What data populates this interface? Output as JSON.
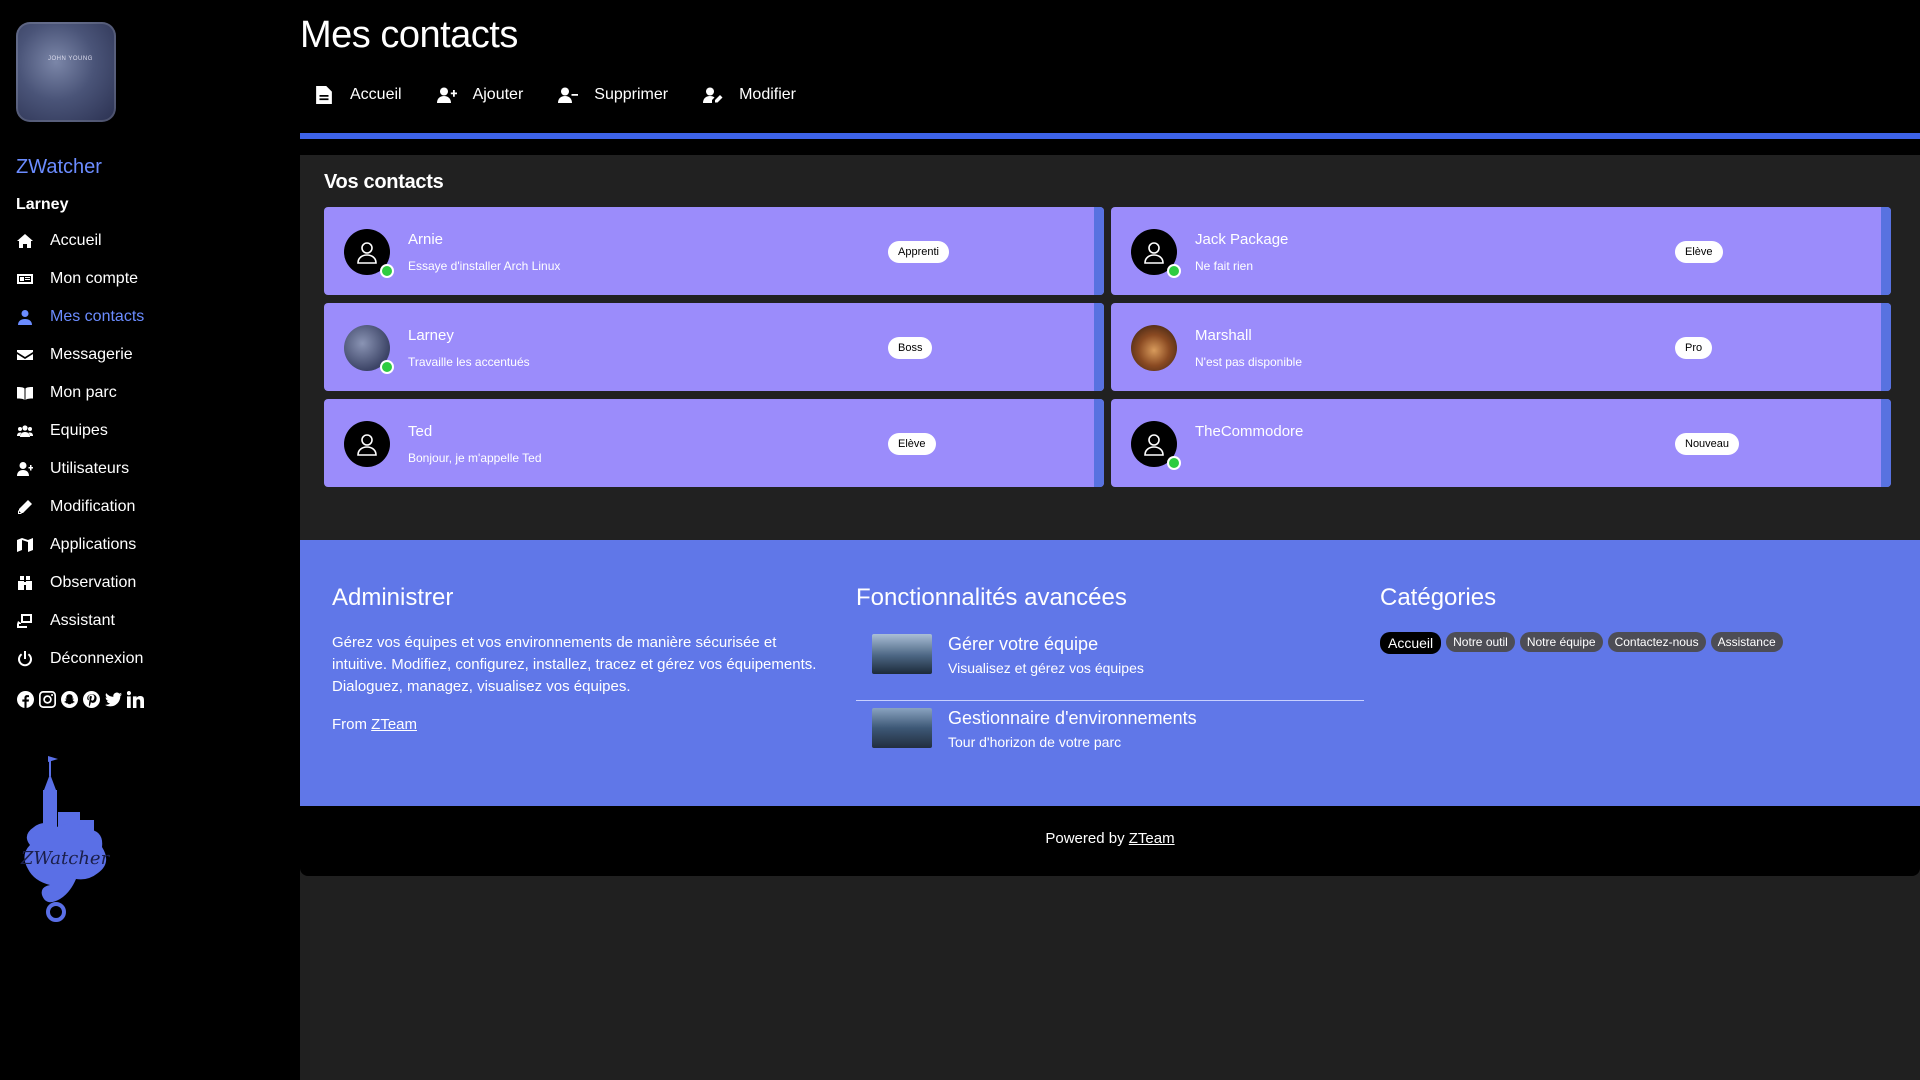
{
  "sidebar": {
    "brand": "ZWatcher",
    "username": "Larney",
    "avatar_text": "JOHN YOUNG",
    "items": [
      {
        "label": "Accueil",
        "icon": "home-icon"
      },
      {
        "label": "Mon compte",
        "icon": "id-card-icon"
      },
      {
        "label": "Mes contacts",
        "icon": "user-icon",
        "active": true
      },
      {
        "label": "Messagerie",
        "icon": "envelope-icon"
      },
      {
        "label": "Mon parc",
        "icon": "book-icon"
      },
      {
        "label": "Equipes",
        "icon": "users-icon"
      },
      {
        "label": "Utilisateurs",
        "icon": "user-plus-icon"
      },
      {
        "label": "Modification",
        "icon": "pencil-icon"
      },
      {
        "label": "Applications",
        "icon": "map-icon"
      },
      {
        "label": "Observation",
        "icon": "binoculars-icon"
      },
      {
        "label": "Assistant",
        "icon": "assistant-icon"
      },
      {
        "label": "Déconnexion",
        "icon": "power-icon"
      }
    ],
    "socials": [
      "facebook-icon",
      "instagram-icon",
      "snapchat-icon",
      "pinterest-icon",
      "twitter-icon",
      "linkedin-icon"
    ],
    "logo_text": "ZWatcher"
  },
  "header": {
    "title": "Mes contacts",
    "tabs": [
      {
        "label": "Accueil",
        "icon": "file-icon"
      },
      {
        "label": "Ajouter",
        "icon": "user-plus-icon"
      },
      {
        "label": "Supprimer",
        "icon": "user-minus-icon"
      },
      {
        "label": "Modifier",
        "icon": "user-edit-icon"
      }
    ]
  },
  "contacts": {
    "title": "Vos contacts",
    "items": [
      {
        "name": "Arnie",
        "status": "Essaye d'installer Arch Linux",
        "badge": "Apprenti",
        "online": true,
        "photo": "none"
      },
      {
        "name": "Jack Package",
        "status": "Ne fait rien",
        "badge": "Elève",
        "online": true,
        "photo": "none"
      },
      {
        "name": "Larney",
        "status": "Travaille les accentués",
        "badge": "Boss",
        "online": true,
        "photo": "larney"
      },
      {
        "name": "Marshall",
        "status": "N'est pas disponible",
        "badge": "Pro",
        "online": false,
        "photo": "marshall"
      },
      {
        "name": "Ted",
        "status": "Bonjour, je m'appelle Ted",
        "badge": "Elève",
        "online": false,
        "photo": "none"
      },
      {
        "name": "TheCommodore",
        "status": "",
        "badge": "Nouveau",
        "online": true,
        "photo": "none"
      }
    ]
  },
  "footer": {
    "admin": {
      "title": "Administrer",
      "text": "Gérez vos équipes et vos environnements de manière sécurisée et intuitive. Modifiez, configurez, installez, tracez et gérez vos équipements. Dialoguez, managez, visualisez vos équipes.",
      "from_prefix": "From ",
      "from_link": "ZTeam"
    },
    "features": {
      "title": "Fonctionnalités avancées",
      "items": [
        {
          "title": "Gérer votre équipe",
          "subtitle": "Visualisez et gérez vos équipes"
        },
        {
          "title": "Gestionnaire d'environnements",
          "subtitle": "Tour d'horizon de votre parc"
        }
      ]
    },
    "categories": {
      "title": "Catégories",
      "items": [
        "Accueil",
        "Notre outil",
        "Notre équipe",
        "Contactez-nous",
        "Assistance"
      ]
    },
    "powered_prefix": "Powered by ",
    "powered_link": "ZTeam"
  },
  "colors": {
    "accent": "#6b8cff",
    "card": "#9b8cfb",
    "footer": "#6077e8",
    "online": "#2ecc40"
  }
}
